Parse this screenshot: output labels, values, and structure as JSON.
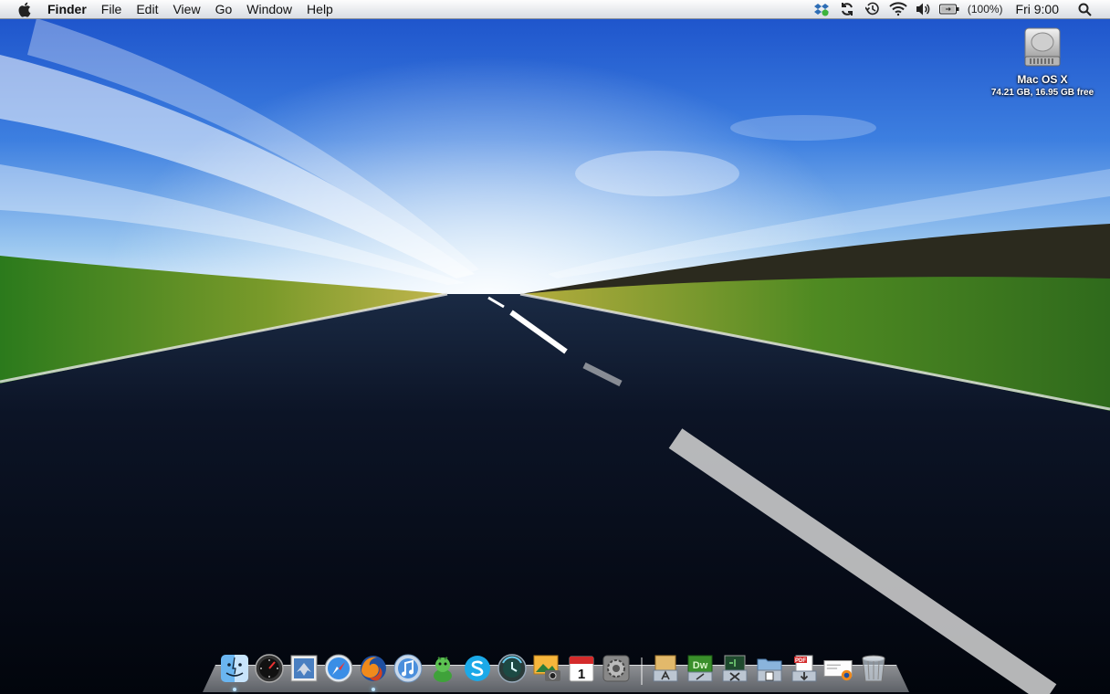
{
  "menubar": {
    "apple_icon": "apple-icon",
    "app_name": "Finder",
    "menus": [
      "File",
      "Edit",
      "View",
      "Go",
      "Window",
      "Help"
    ],
    "battery_text": "(100%)",
    "clock": "Fri 9:00",
    "status_icons": [
      "dropbox-icon",
      "sync-icon",
      "time-machine-icon",
      "wifi-icon",
      "volume-icon",
      "battery-icon",
      "spotlight-icon"
    ]
  },
  "desktop": {
    "drive_name": "Mac OS X",
    "drive_info": "74.21 GB, 16.95 GB free"
  },
  "dock": {
    "apps": [
      {
        "name": "finder-icon",
        "running": true
      },
      {
        "name": "dashboard-icon",
        "running": false
      },
      {
        "name": "mail-icon",
        "running": false
      },
      {
        "name": "safari-icon",
        "running": false
      },
      {
        "name": "firefox-icon",
        "running": true
      },
      {
        "name": "itunes-icon",
        "running": false
      },
      {
        "name": "adium-icon",
        "running": false
      },
      {
        "name": "skype-icon",
        "running": false
      },
      {
        "name": "time-machine-icon",
        "running": false
      },
      {
        "name": "iphoto-icon",
        "running": false
      },
      {
        "name": "ical-icon",
        "running": false,
        "day": "1"
      },
      {
        "name": "system-preferences-icon",
        "running": false
      }
    ],
    "stacks": [
      {
        "name": "applications-stack-icon"
      },
      {
        "name": "dreamweaver-stack-icon",
        "label": "Dw"
      },
      {
        "name": "utilities-stack-icon"
      },
      {
        "name": "documents-stack-icon"
      },
      {
        "name": "downloads-stack-icon",
        "label": "PDF"
      },
      {
        "name": "firefox-downloads-icon"
      },
      {
        "name": "trash-icon"
      }
    ]
  }
}
